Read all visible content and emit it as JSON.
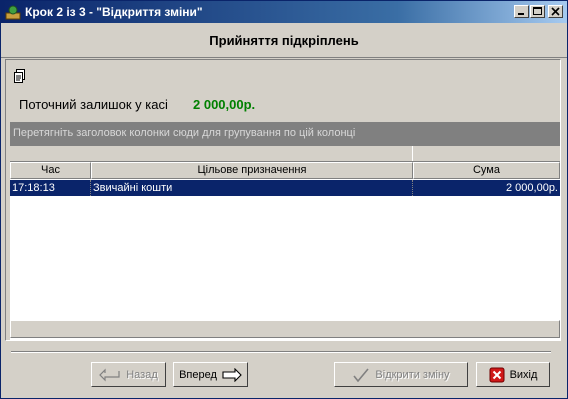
{
  "window": {
    "title": "Крок 2 із 3 - \"Відкриття зміни\""
  },
  "header": {
    "title": "Прийняття підкріплень"
  },
  "balance": {
    "label": "Поточний залишок у касі",
    "value": "2 000,00р."
  },
  "grid": {
    "group_hint": "Перетягніть заголовок колонки сюди для групування по цій колонці",
    "columns": [
      "Час",
      "Цільове призначення",
      "Сума"
    ],
    "rows": [
      {
        "time": "17:18:13",
        "purpose": "Звичайні кошти",
        "amount": "2 000,00р."
      }
    ]
  },
  "buttons": {
    "back": "Назад",
    "forward": "Вперед",
    "open_shift": "Відкрити зміну",
    "exit": "Вихід"
  },
  "colors": {
    "accent_value": "#008000",
    "selection": "#0a246a",
    "titlebar": "#0a246a"
  }
}
